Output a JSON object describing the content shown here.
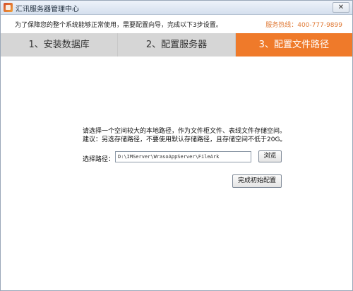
{
  "window": {
    "title": "汇讯服务器管理中心",
    "close_label": "✕"
  },
  "notice": {
    "text": "为了保障您的整个系统能够正常使用，需要配置向导，完成以下3步设置。",
    "hotline": "服务热线：400-777-9899"
  },
  "steps": [
    {
      "label": "1、安装数据库",
      "active": false
    },
    {
      "label": "2、配置服务器",
      "active": false
    },
    {
      "label": "3、配置文件路径",
      "active": true
    }
  ],
  "content": {
    "description_line1": "请选择一个空间较大的本地路径，作为文件柜文件、表线文件存储空间。",
    "description_line2": "建议：另选存储路径，不要使用默认存储路径，且存储空间不低于20G。",
    "path_label": "选择路径：",
    "path_value": "D:\\IMServer\\WrasoAppServer\\FileArk",
    "browse_label": "浏览",
    "finish_label": "完成初始配置"
  },
  "colors": {
    "active_step": "#ef7a2a",
    "step_bar": "#d6d6d6",
    "hotline": "#e07a36"
  }
}
